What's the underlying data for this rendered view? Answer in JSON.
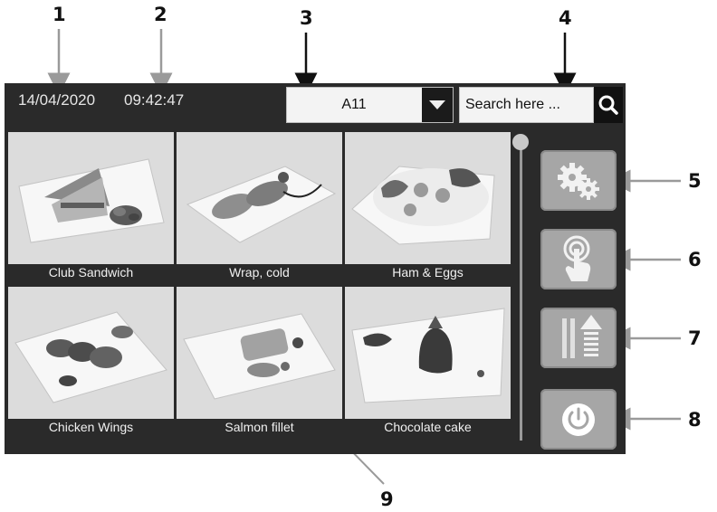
{
  "callouts": [
    "1",
    "2",
    "3",
    "4",
    "5",
    "6",
    "7",
    "8",
    "9"
  ],
  "header": {
    "date": "14/04/2020",
    "time": "09:42:47",
    "table_selector": {
      "selected": "A11"
    },
    "search": {
      "placeholder": "Search here ..."
    }
  },
  "menu": {
    "items": [
      {
        "name": "Club Sandwich"
      },
      {
        "name": "Wrap, cold"
      },
      {
        "name": "Ham & Eggs"
      },
      {
        "name": "Chicken Wings"
      },
      {
        "name": "Salmon fillet"
      },
      {
        "name": "Chocolate cake"
      }
    ]
  },
  "side_buttons": [
    {
      "icon": "gears-icon"
    },
    {
      "icon": "touch-hand-icon"
    },
    {
      "icon": "level-up-icon"
    },
    {
      "icon": "power-icon"
    }
  ],
  "colors": {
    "screen_bg": "#2a2a2a",
    "button_bg": "#a6a6a6",
    "tile_bg": "#dcdcdc"
  }
}
